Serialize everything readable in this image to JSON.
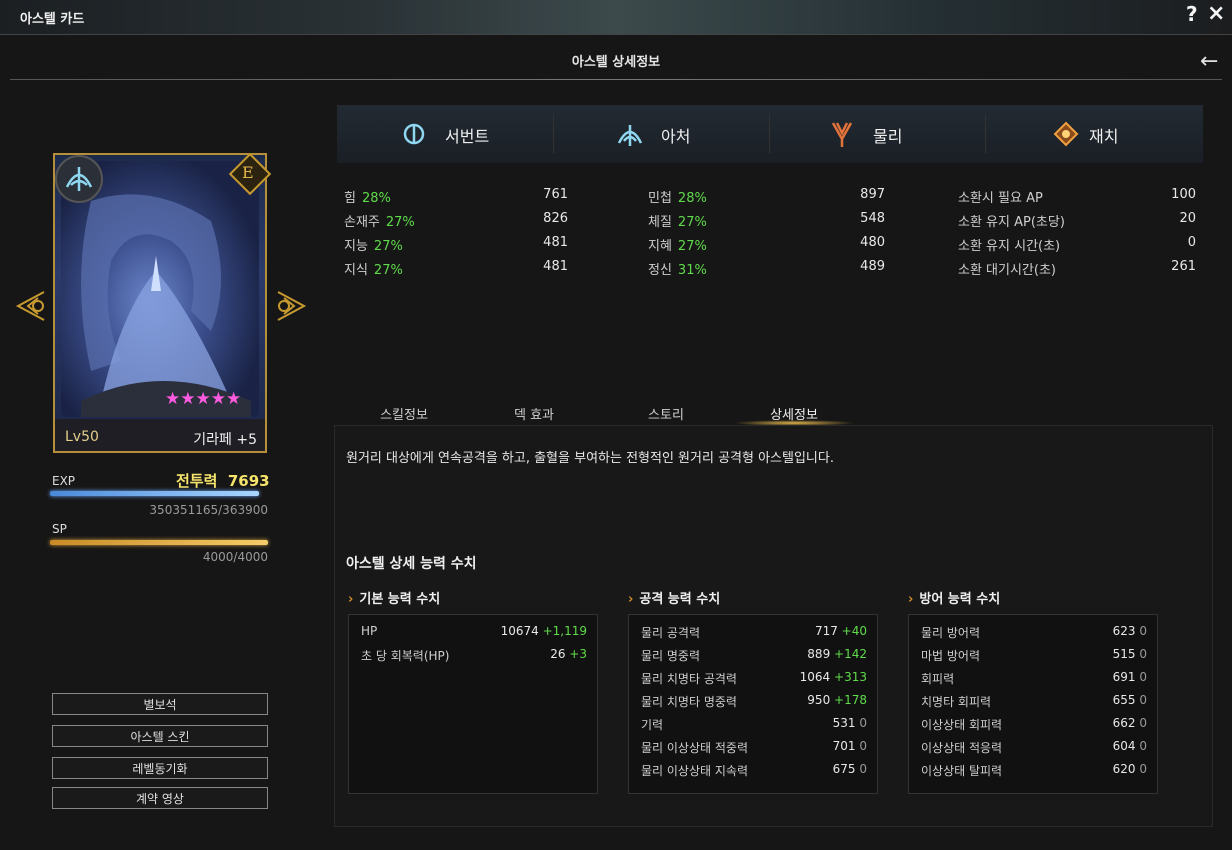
{
  "window": {
    "title": "아스텔 카드",
    "help": "?",
    "close": "×"
  },
  "header": {
    "title": "아스텔 상세정보",
    "back": "←"
  },
  "card": {
    "level": "Lv50",
    "name": "기라페 +5",
    "grade": "E",
    "stars": "★★★★★",
    "star_color": "#ff5be0"
  },
  "power": {
    "label": "전투력",
    "value": "7693"
  },
  "exp": {
    "label": "EXP",
    "value": "350351165/363900",
    "fill": 0.96
  },
  "sp": {
    "label": "SP",
    "value": "4000/4000",
    "fill": 1.0
  },
  "left_buttons": [
    "별보석",
    "아스텔 스킨",
    "레벨동기화",
    "계약 영상"
  ],
  "elements": [
    {
      "icon": "servant-icon",
      "label": "서번트",
      "color": "#8fd7f0"
    },
    {
      "icon": "archer-icon",
      "label": "아처",
      "color": "#8fd7f0"
    },
    {
      "icon": "physical-icon",
      "label": "물리",
      "color": "#e2733a"
    },
    {
      "icon": "gem-icon",
      "label": "재치",
      "color": "#f0a040"
    }
  ],
  "stats_col1": [
    {
      "name": "힘",
      "pct": "28%",
      "value": "761"
    },
    {
      "name": "손재주",
      "pct": "27%",
      "value": "826"
    },
    {
      "name": "지능",
      "pct": "27%",
      "value": "481"
    },
    {
      "name": "지식",
      "pct": "27%",
      "value": "481"
    }
  ],
  "stats_col2": [
    {
      "name": "민첩",
      "pct": "28%",
      "value": "897"
    },
    {
      "name": "체질",
      "pct": "27%",
      "value": "548"
    },
    {
      "name": "지혜",
      "pct": "27%",
      "value": "480"
    },
    {
      "name": "정신",
      "pct": "31%",
      "value": "489"
    }
  ],
  "stats_col3": [
    {
      "name": "소환시 필요 AP",
      "value": "100"
    },
    {
      "name": "소환 유지 AP(초당)",
      "value": "20"
    },
    {
      "name": "소환 유지 시간(초)",
      "value": "0"
    },
    {
      "name": "소환 대기시간(초)",
      "value": "261"
    }
  ],
  "tabs": [
    "스킬정보",
    "덱 효과",
    "스토리",
    "상세정보"
  ],
  "active_tab": "상세정보",
  "description": "원거리 대상에게 연속공격을 하고, 출혈을 부여하는 전형적인 원거리 공격형 아스텔입니다.",
  "detail_title": "아스텔 상세 능력 수치",
  "groups": [
    {
      "title": "기본 능력 수치",
      "rows": [
        {
          "name": "HP",
          "value": "10674",
          "bonus": "+1,119"
        },
        {
          "name": "초 당 회복력(HP)",
          "value": "26",
          "bonus": "+3"
        }
      ]
    },
    {
      "title": "공격 능력 수치",
      "rows": [
        {
          "name": "물리 공격력",
          "value": "717",
          "bonus": "+40"
        },
        {
          "name": "물리 명중력",
          "value": "889",
          "bonus": "+142"
        },
        {
          "name": "물리 치명타 공격력",
          "value": "1064",
          "bonus": "+313"
        },
        {
          "name": "물리 치명타 명중력",
          "value": "950",
          "bonus": "+178"
        },
        {
          "name": "기력",
          "value": "531",
          "zero": "0"
        },
        {
          "name": "물리 이상상태 적중력",
          "value": "701",
          "zero": "0"
        },
        {
          "name": "물리 이상상태 지속력",
          "value": "675",
          "zero": "0"
        }
      ]
    },
    {
      "title": "방어 능력 수치",
      "rows": [
        {
          "name": "물리 방어력",
          "value": "623",
          "zero": "0"
        },
        {
          "name": "마법 방어력",
          "value": "515",
          "zero": "0"
        },
        {
          "name": "회피력",
          "value": "691",
          "zero": "0"
        },
        {
          "name": "치명타 회피력",
          "value": "655",
          "zero": "0"
        },
        {
          "name": "이상상태 회피력",
          "value": "662",
          "zero": "0"
        },
        {
          "name": "이상상태 적응력",
          "value": "604",
          "zero": "0"
        },
        {
          "name": "이상상태 탈피력",
          "value": "620",
          "zero": "0"
        }
      ]
    }
  ]
}
